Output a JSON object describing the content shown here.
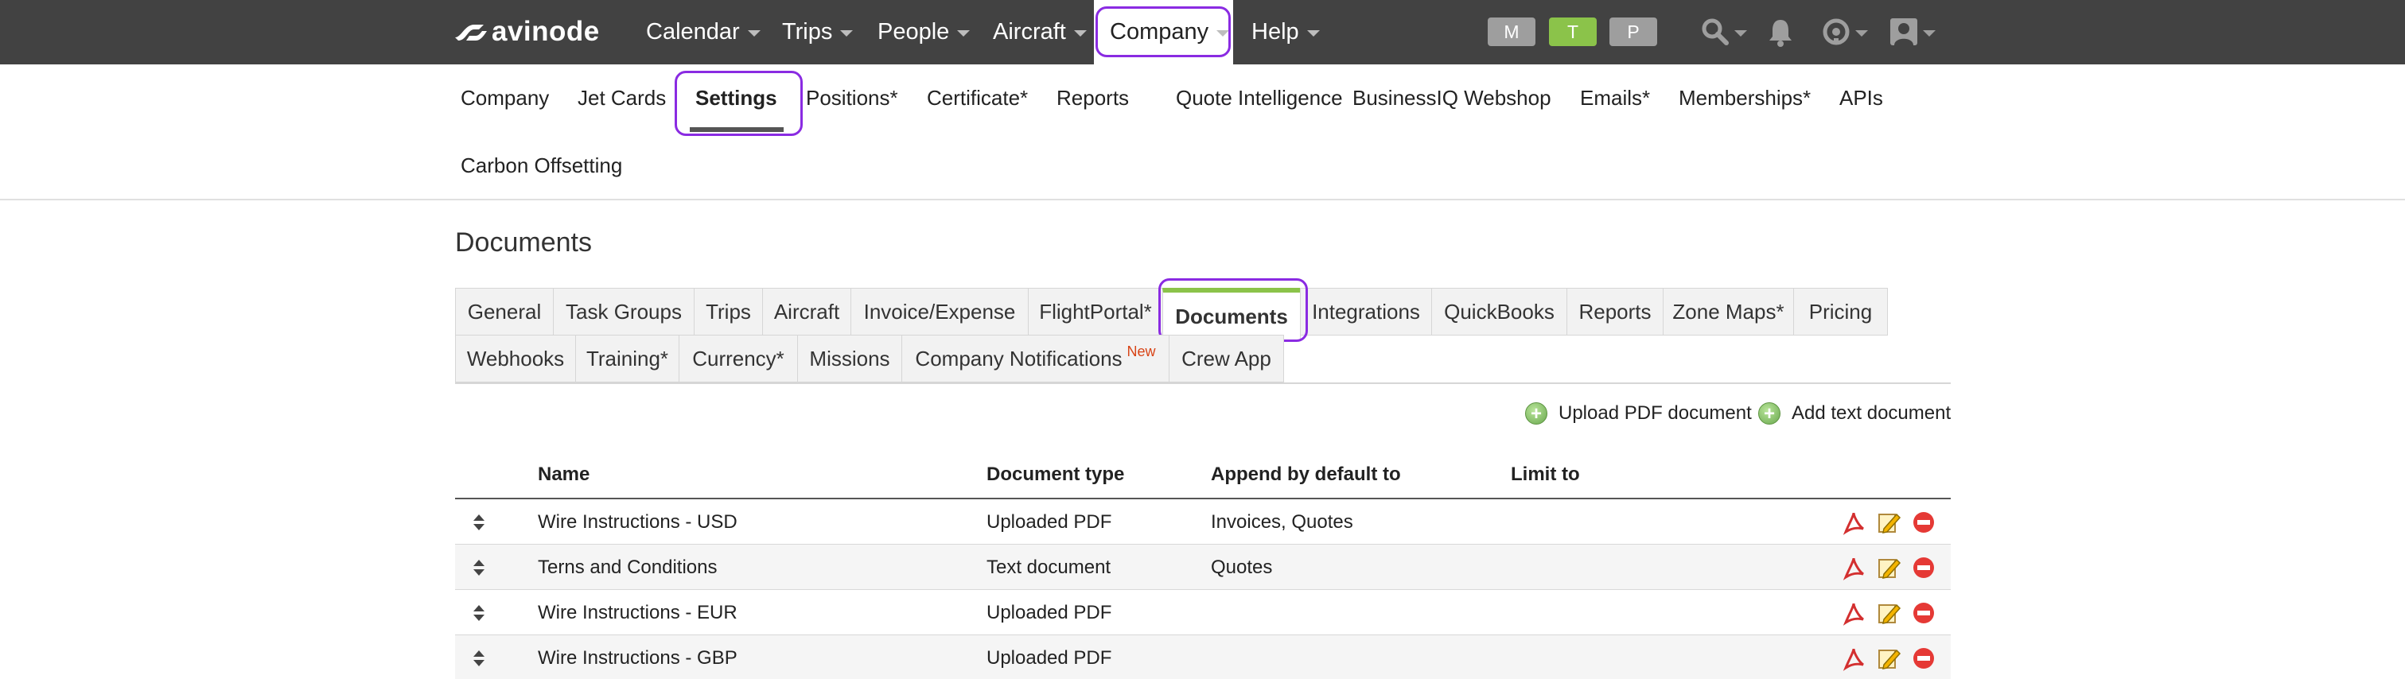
{
  "brand": {
    "name": "avinode"
  },
  "topnav": {
    "items": [
      {
        "label": "Calendar"
      },
      {
        "label": "Trips"
      },
      {
        "label": "People"
      },
      {
        "label": "Aircraft"
      },
      {
        "label": "Company"
      },
      {
        "label": "Help"
      }
    ],
    "active": "Company",
    "pills": [
      {
        "label": "M",
        "color": "#9e9e9e"
      },
      {
        "label": "T",
        "color": "#8bc34a"
      },
      {
        "label": "P",
        "color": "#9e9e9e"
      }
    ],
    "icons": [
      "search-icon",
      "bell-icon",
      "support-icon",
      "user-avatar-icon"
    ]
  },
  "subnav": {
    "items": [
      {
        "label": "Company"
      },
      {
        "label": "Jet Cards"
      },
      {
        "label": "Settings"
      },
      {
        "label": "Positions*"
      },
      {
        "label": "Certificate*"
      },
      {
        "label": "Reports"
      },
      {
        "label": "Quote Intelligence"
      },
      {
        "label": "BusinessIQ Webshop"
      },
      {
        "label": "Emails*"
      },
      {
        "label": "Memberships*"
      },
      {
        "label": "APIs"
      },
      {
        "label": "Carbon Offsetting"
      }
    ],
    "active": "Settings"
  },
  "page": {
    "title": "Documents"
  },
  "tabs": {
    "row1": [
      {
        "label": "General"
      },
      {
        "label": "Task Groups"
      },
      {
        "label": "Trips"
      },
      {
        "label": "Aircraft"
      },
      {
        "label": "Invoice/Expense"
      },
      {
        "label": "FlightPortal*"
      },
      {
        "label": "Documents"
      },
      {
        "label": "Integrations"
      },
      {
        "label": "QuickBooks"
      },
      {
        "label": "Reports"
      },
      {
        "label": "Zone Maps*"
      },
      {
        "label": "Pricing"
      }
    ],
    "row2": [
      {
        "label": "Webhooks"
      },
      {
        "label": "Training*"
      },
      {
        "label": "Currency*"
      },
      {
        "label": "Missions"
      },
      {
        "label": "Company Notifications",
        "badge": "New"
      },
      {
        "label": "Crew App"
      }
    ],
    "active": "Documents",
    "active_color": "#8bc34a"
  },
  "actions": {
    "upload_pdf": "Upload PDF document",
    "add_text": "Add text document"
  },
  "table": {
    "headers": {
      "name": "Name",
      "type": "Document type",
      "append": "Append by default to",
      "limit": "Limit to"
    },
    "rows": [
      {
        "name": "Wire Instructions - USD",
        "type": "Uploaded PDF",
        "append": "Invoices, Quotes",
        "limit": ""
      },
      {
        "name": "Terns and Conditions",
        "type": "Text document",
        "append": "Quotes",
        "limit": ""
      },
      {
        "name": "Wire Instructions - EUR",
        "type": "Uploaded PDF",
        "append": "",
        "limit": ""
      },
      {
        "name": "Wire Instructions - GBP",
        "type": "Uploaded PDF",
        "append": "",
        "limit": ""
      }
    ],
    "row_icons": [
      "pdf-icon",
      "edit-icon",
      "delete-icon"
    ]
  },
  "colors": {
    "topbar": "#424242",
    "highlight": "#8a2be2",
    "accent": "#8bc34a"
  }
}
